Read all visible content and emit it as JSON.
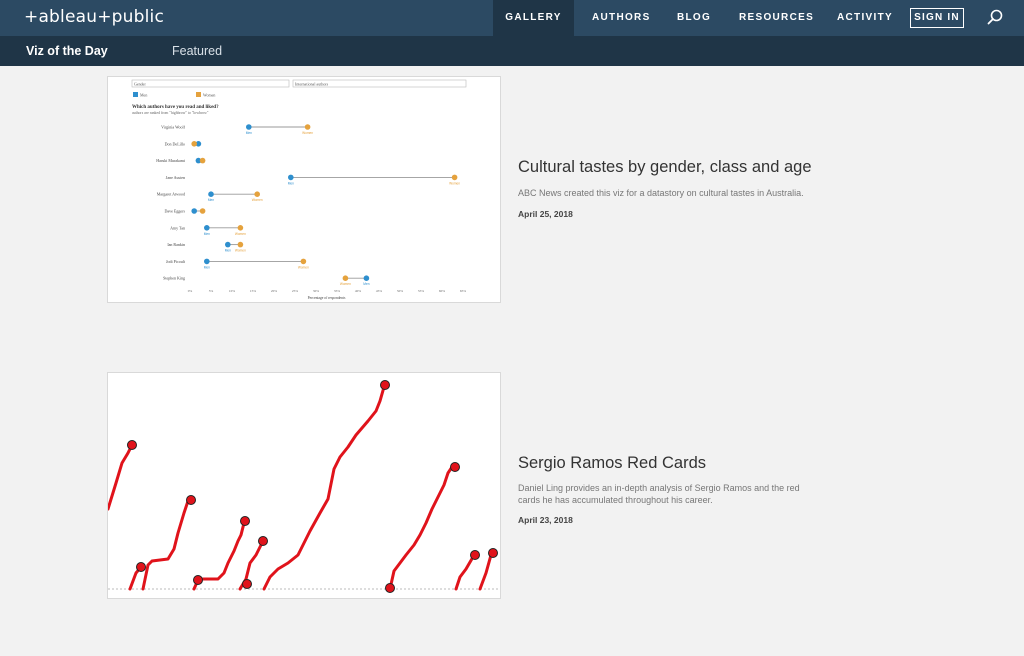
{
  "brand": {
    "logo_text": "+ableau+public"
  },
  "nav": {
    "items": [
      {
        "label": "GALLERY",
        "active": true
      },
      {
        "label": "AUTHORS"
      },
      {
        "label": "BLOG"
      },
      {
        "label": "RESOURCES"
      },
      {
        "label": "ACTIVITY"
      }
    ],
    "signin_label": "SIGN IN",
    "search_icon": "search-icon"
  },
  "subnav": {
    "items": [
      {
        "label": "Viz of the Day",
        "active": true
      },
      {
        "label": "Featured"
      }
    ]
  },
  "cards": [
    {
      "title": "Cultural tastes by gender, class and age",
      "desc": "ABC News created this viz for a datastory on cultural tastes in Australia.",
      "date": "April 25, 2018",
      "thumb": {
        "filter1": "Gender",
        "filter2": "International authors",
        "legend": [
          "Men",
          "Women"
        ],
        "question": "Which authors have you read and liked?",
        "subtext": "authors are ranked from \"highbrow\" to \"lowbrow\"",
        "authors": [
          "Virginia Woolf",
          "Don DeLillo",
          "Haruki Murakami",
          "Jane Austen",
          "Margaret Atwood",
          "Dave Eggers",
          "Amy Tan",
          "Ian Rankin",
          "Jodi Picoult",
          "Stephen King"
        ],
        "men": [
          14,
          2,
          2,
          24,
          5,
          1,
          4,
          9,
          4,
          42
        ],
        "women": [
          28,
          1,
          3,
          63,
          16,
          3,
          12,
          12,
          27,
          37
        ],
        "ticks": [
          "0%",
          "5%",
          "10%",
          "15%",
          "20%",
          "25%",
          "30%",
          "35%",
          "40%",
          "45%",
          "50%",
          "55%",
          "60%",
          "65%"
        ],
        "xlabel": "Percentage of respondents",
        "colors": {
          "men": "#2e8fce",
          "women": "#e5a23d"
        }
      }
    },
    {
      "title": "Sergio Ramos Red Cards",
      "desc": "Daniel Ling provides an in-depth analysis of Sergio Ramos and the red cards he has accumulated throughout his career.",
      "date": "April 23, 2018"
    }
  ]
}
